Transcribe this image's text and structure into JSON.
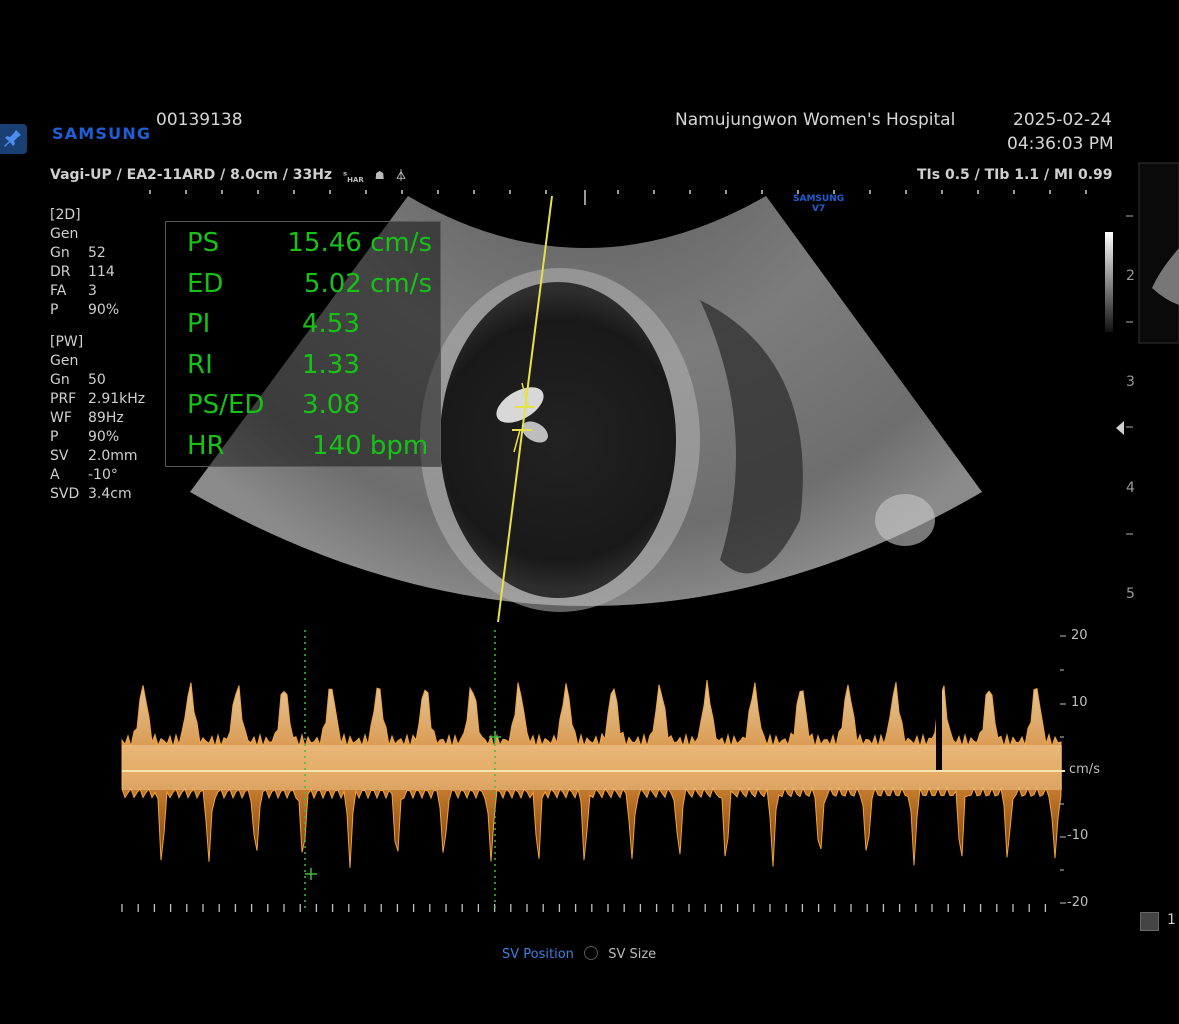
{
  "header": {
    "patient_id": "00139138",
    "hospital": "Namujungwon Women's  Hospital",
    "date": "2025-02-24",
    "time": "04:36:03 PM",
    "brand": "SAMSUNG",
    "probe_info": "Vagi-UP / EA2-11ARD / 8.0cm / 33Hz",
    "tis_info": "TIs  0.5 / TIb  1.1 / MI  0.99",
    "small_brand": "SAMSUNG",
    "small_model": "V7"
  },
  "params_2d": [
    {
      "k": "[2D]",
      "v": ""
    },
    {
      "k": "Gen",
      "v": ""
    },
    {
      "k": "Gn",
      "v": "52"
    },
    {
      "k": "DR",
      "v": "114"
    },
    {
      "k": "FA",
      "v": "3"
    },
    {
      "k": "P",
      "v": "90%"
    }
  ],
  "params_pw": [
    {
      "k": "[PW]",
      "v": ""
    },
    {
      "k": "Gen",
      "v": ""
    },
    {
      "k": "Gn",
      "v": "50"
    },
    {
      "k": "PRF",
      "v": "2.91kHz"
    },
    {
      "k": "WF",
      "v": "89Hz"
    },
    {
      "k": "P",
      "v": "90%"
    },
    {
      "k": "SV",
      "v": "2.0mm"
    },
    {
      "k": "A",
      "v": "-10°"
    },
    {
      "k": "SVD",
      "v": "3.4cm"
    }
  ],
  "measurements": [
    {
      "label": "PS",
      "value": "15.46 cm/s"
    },
    {
      "label": "ED",
      "value": "5.02 cm/s"
    },
    {
      "label": "PI",
      "value": "4.53"
    },
    {
      "label": "RI",
      "value": "1.33"
    },
    {
      "label": "PS/ED",
      "value": "3.08"
    },
    {
      "label": "HR",
      "value": "140 bpm"
    }
  ],
  "depth_scale": [
    "2",
    "3",
    "4",
    "5"
  ],
  "velocity_scale": {
    "labels": [
      "20",
      "10",
      "cm/s",
      "-10",
      "-20"
    ],
    "unit": "cm/s"
  },
  "bottom_tabs": [
    "SV Position",
    "SV Size"
  ],
  "side_number": "1",
  "colors": {
    "measure_text": "#17c217",
    "brand_blue": "#1f5fd6",
    "doppler_trace": "#f1a43a",
    "cursor_line": "#e6e04a"
  },
  "icons": [
    "pin-icon",
    "harmonic-icon",
    "probe-icon",
    "focus-icon",
    "focus-arrow-icon"
  ]
}
